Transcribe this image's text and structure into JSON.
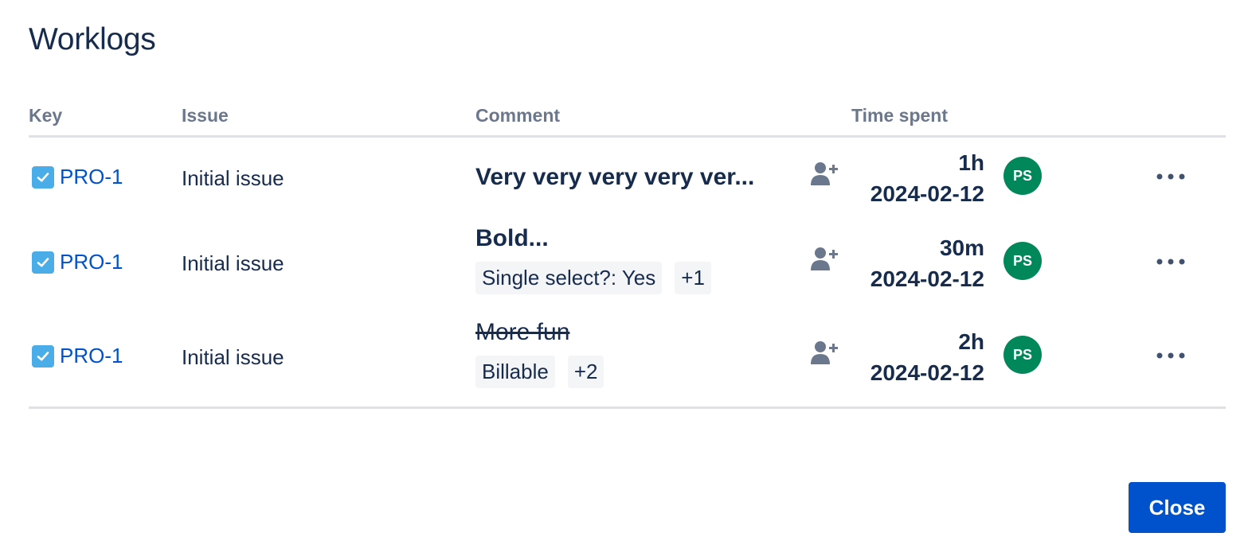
{
  "dialog": {
    "title": "Worklogs",
    "close_label": "Close"
  },
  "columns": {
    "key": "Key",
    "issue": "Issue",
    "comment": "Comment",
    "time_spent": "Time spent"
  },
  "rows": [
    {
      "key": "PRO-1",
      "issue": "Initial issue",
      "comment": "Very very very very ver...",
      "comment_style": "bold",
      "attributes": [],
      "time": "1h",
      "date": "2024-02-12",
      "avatar_initials": "PS"
    },
    {
      "key": "PRO-1",
      "issue": "Initial issue",
      "comment": "Bold...",
      "comment_style": "bold",
      "attributes": [
        "Single select?: Yes",
        "+1"
      ],
      "time": "30m",
      "date": "2024-02-12",
      "avatar_initials": "PS"
    },
    {
      "key": "PRO-1",
      "issue": "Initial issue",
      "comment": "More fun",
      "comment_style": "strikethrough",
      "attributes": [
        "Billable",
        "+2"
      ],
      "time": "2h",
      "date": "2024-02-12",
      "avatar_initials": "PS"
    }
  ],
  "icons": {
    "issue_type": "checkbox-task-icon",
    "assign": "person-add-icon",
    "more": "more-horizontal-icon"
  },
  "colors": {
    "link": "#0052cc",
    "primary_button": "#0052cc",
    "avatar_bg": "#00875a",
    "task_icon": "#4bade8",
    "heading_text": "#172b4d",
    "column_header": "#6b778c"
  }
}
